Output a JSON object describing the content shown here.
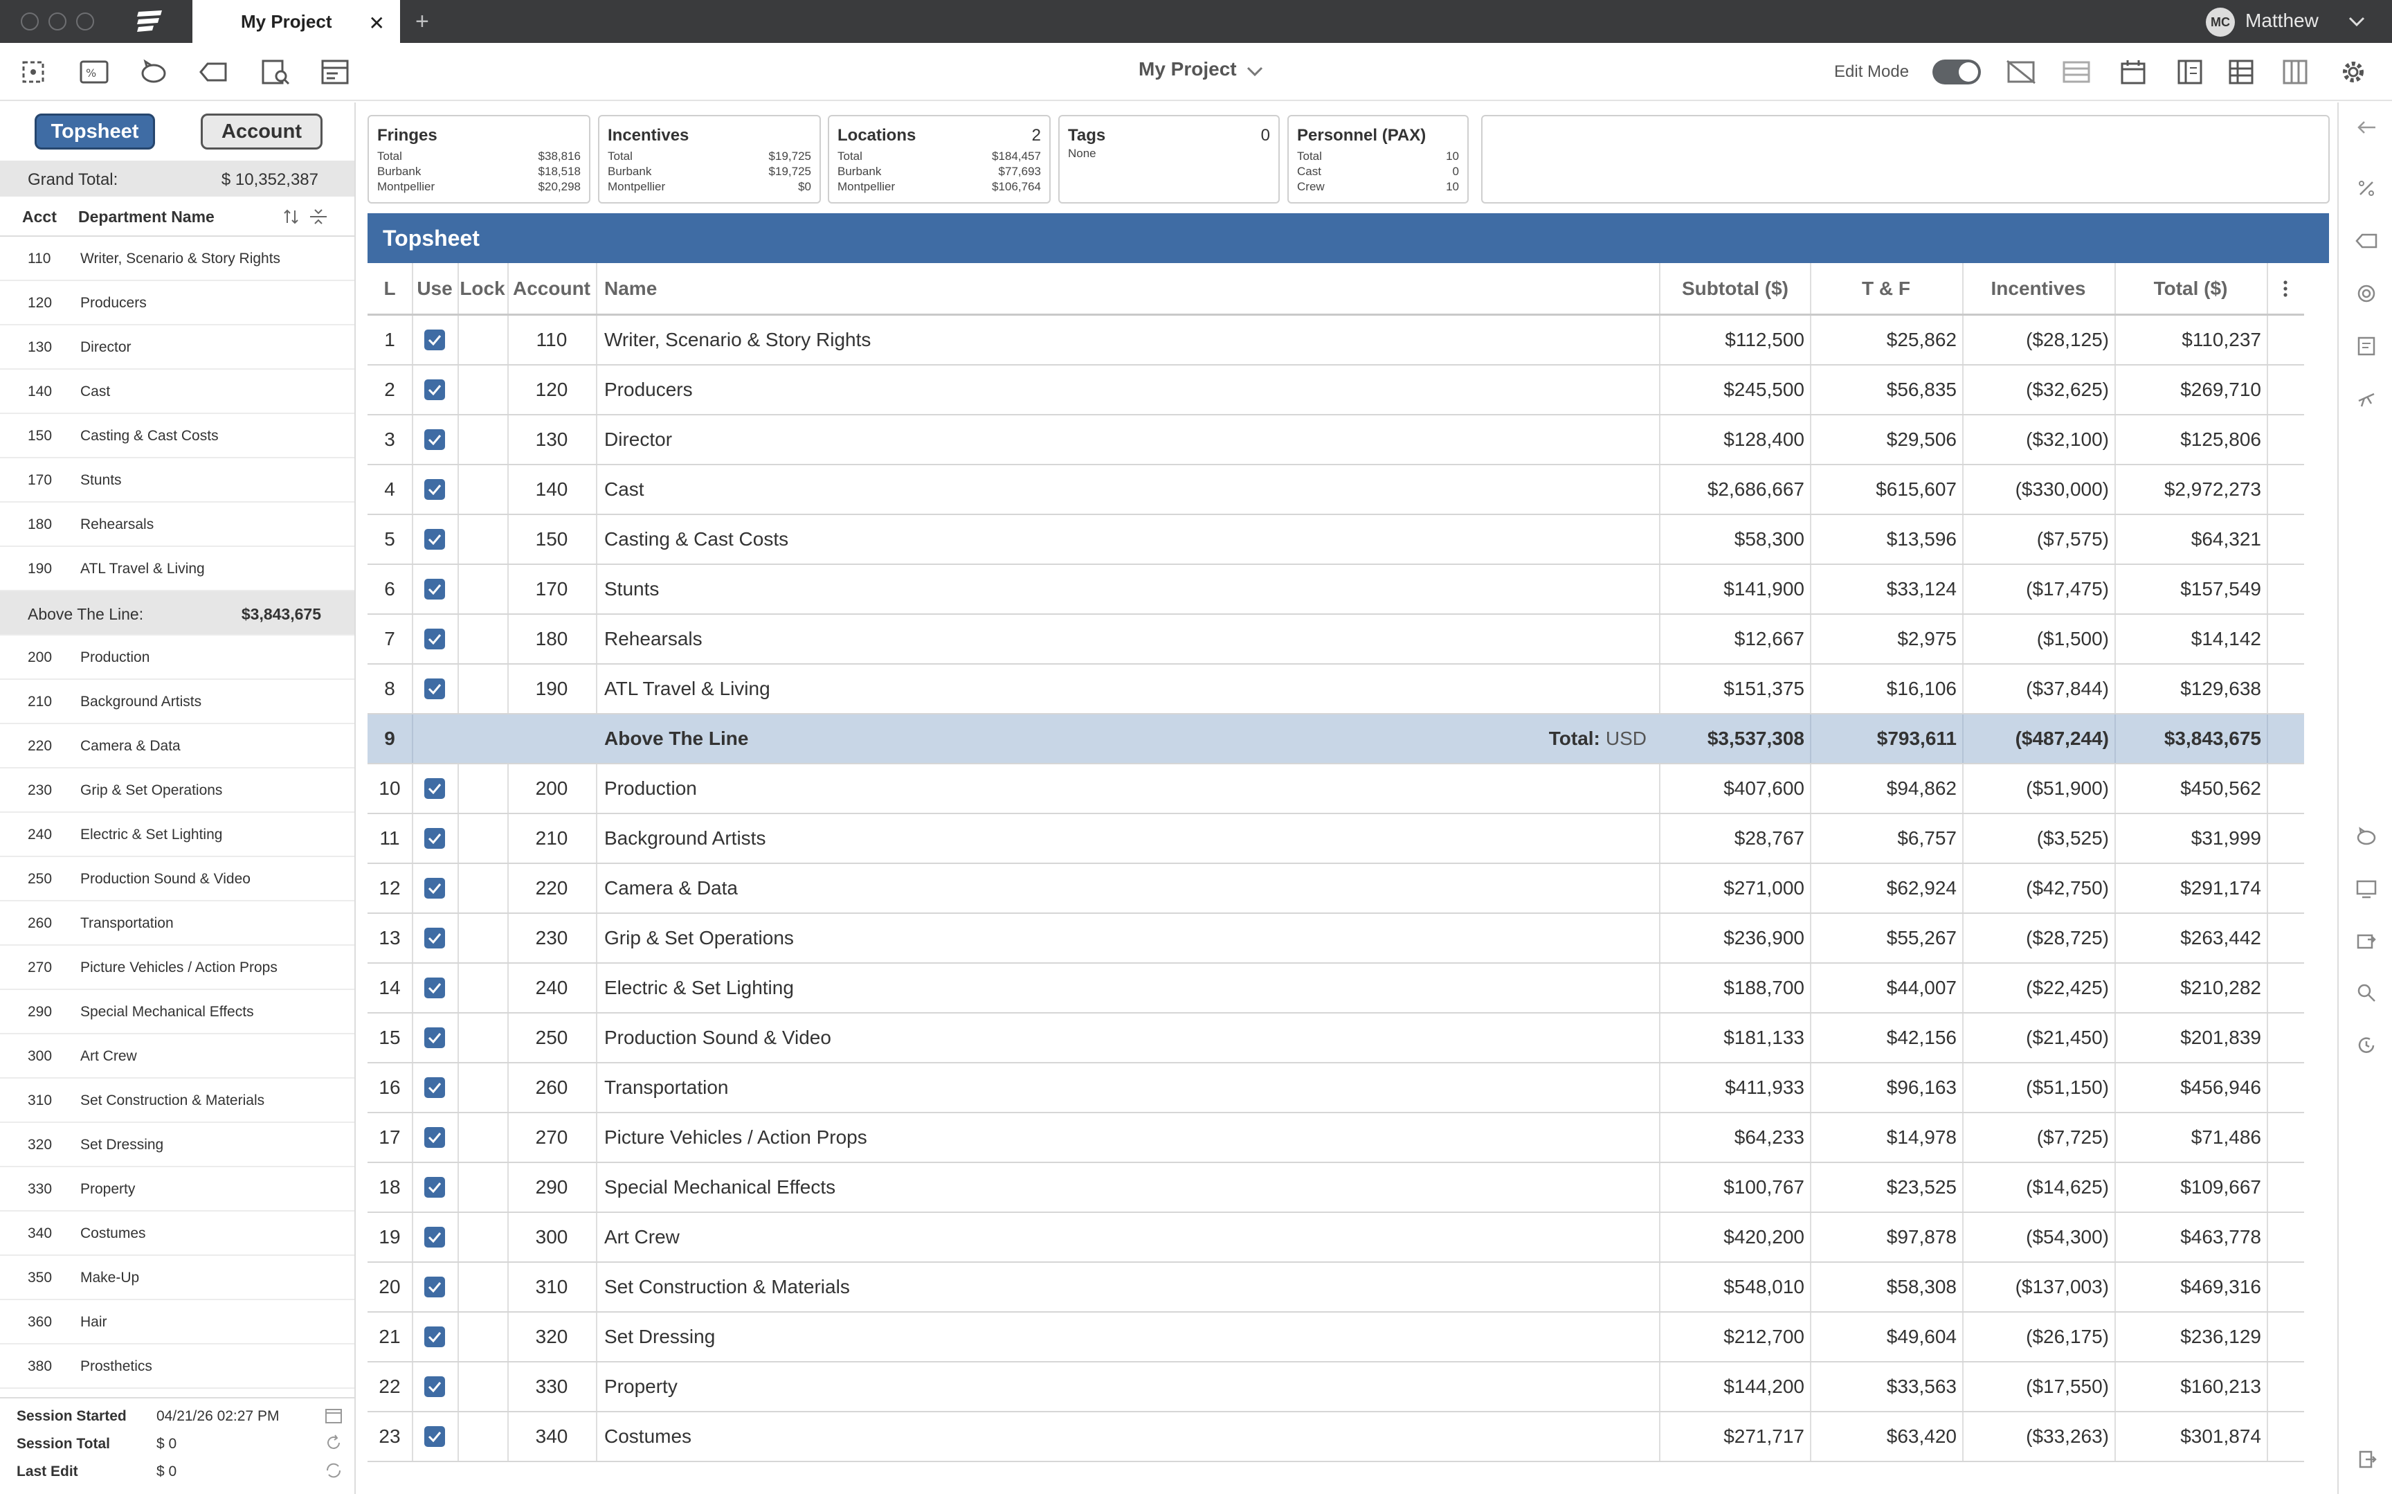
{
  "tab": {
    "title": "My Project"
  },
  "user": {
    "initials": "MC",
    "name": "Matthew"
  },
  "toolbar": {
    "project_title": "My Project",
    "edit_mode_label": "Edit Mode",
    "edit_mode_on": true
  },
  "sidebar": {
    "seg_topsheet": "Topsheet",
    "seg_account": "Account",
    "grand_total_label": "Grand Total:",
    "grand_total_value": "$ 10,352,387",
    "col_acct": "Acct",
    "col_name": "Department Name",
    "rows": [
      {
        "acct": "110",
        "name": "Writer, Scenario & Story Rights"
      },
      {
        "acct": "120",
        "name": "Producers"
      },
      {
        "acct": "130",
        "name": "Director"
      },
      {
        "acct": "140",
        "name": "Cast"
      },
      {
        "acct": "150",
        "name": "Casting & Cast Costs"
      },
      {
        "acct": "170",
        "name": "Stunts"
      },
      {
        "acct": "180",
        "name": "Rehearsals"
      },
      {
        "acct": "190",
        "name": "ATL Travel & Living"
      },
      {
        "acct": "",
        "name": "Above The Line:",
        "total": "$3,843,675",
        "subtotal": true
      },
      {
        "acct": "200",
        "name": "Production"
      },
      {
        "acct": "210",
        "name": "Background Artists"
      },
      {
        "acct": "220",
        "name": "Camera & Data"
      },
      {
        "acct": "230",
        "name": "Grip & Set Operations"
      },
      {
        "acct": "240",
        "name": "Electric & Set Lighting"
      },
      {
        "acct": "250",
        "name": "Production Sound & Video"
      },
      {
        "acct": "260",
        "name": "Transportation"
      },
      {
        "acct": "270",
        "name": "Picture Vehicles / Action Props"
      },
      {
        "acct": "290",
        "name": "Special Mechanical Effects"
      },
      {
        "acct": "300",
        "name": "Art Crew"
      },
      {
        "acct": "310",
        "name": "Set Construction & Materials"
      },
      {
        "acct": "320",
        "name": "Set Dressing"
      },
      {
        "acct": "330",
        "name": "Property"
      },
      {
        "acct": "340",
        "name": "Costumes"
      },
      {
        "acct": "350",
        "name": "Make-Up"
      },
      {
        "acct": "360",
        "name": "Hair"
      },
      {
        "acct": "380",
        "name": "Prosthetics"
      }
    ],
    "session": {
      "started_label": "Session Started",
      "started_value": "04/21/26   02:27 PM",
      "total_label": "Session Total",
      "total_value": "$ 0",
      "last_edit_label": "Last Edit",
      "last_edit_value": "$ 0"
    }
  },
  "cards": {
    "fringes": {
      "title": "Fringes",
      "lines": [
        [
          "Total",
          "$38,816"
        ],
        [
          "Burbank",
          "$18,518"
        ],
        [
          "Montpellier",
          "$20,298"
        ]
      ]
    },
    "incentives": {
      "title": "Incentives",
      "lines": [
        [
          "Total",
          "$19,725"
        ],
        [
          "Burbank",
          "$19,725"
        ],
        [
          "Montpellier",
          "$0"
        ]
      ]
    },
    "locations": {
      "title": "Locations",
      "count": "2",
      "lines": [
        [
          "Total",
          "$184,457"
        ],
        [
          "Burbank",
          "$77,693"
        ],
        [
          "Montpellier",
          "$106,764"
        ]
      ]
    },
    "tags": {
      "title": "Tags",
      "count": "0",
      "lines": [
        [
          "None",
          ""
        ]
      ]
    },
    "personnel": {
      "title": "Personnel (PAX)",
      "lines": [
        [
          "Total",
          "10"
        ],
        [
          "Cast",
          "0"
        ],
        [
          "Crew",
          "10"
        ]
      ]
    }
  },
  "topsheet": {
    "title": "Topsheet",
    "columns": {
      "l": "L",
      "use": "Use",
      "lock": "Lock",
      "account": "Account",
      "name": "Name",
      "subtotal": "Subtotal ($)",
      "tf": "T & F",
      "incentives": "Incentives",
      "total": "Total ($)"
    },
    "total_label": "Total:",
    "currency": "USD",
    "rows": [
      {
        "l": "1",
        "acct": "110",
        "name": "Writer, Scenario & Story Rights",
        "subtotal": "$112,500",
        "tf": "$25,862",
        "inc": "($28,125)",
        "total": "$110,237"
      },
      {
        "l": "2",
        "acct": "120",
        "name": "Producers",
        "subtotal": "$245,500",
        "tf": "$56,835",
        "inc": "($32,625)",
        "total": "$269,710"
      },
      {
        "l": "3",
        "acct": "130",
        "name": "Director",
        "subtotal": "$128,400",
        "tf": "$29,506",
        "inc": "($32,100)",
        "total": "$125,806"
      },
      {
        "l": "4",
        "acct": "140",
        "name": "Cast",
        "subtotal": "$2,686,667",
        "tf": "$615,607",
        "inc": "($330,000)",
        "total": "$2,972,273"
      },
      {
        "l": "5",
        "acct": "150",
        "name": "Casting & Cast Costs",
        "subtotal": "$58,300",
        "tf": "$13,596",
        "inc": "($7,575)",
        "total": "$64,321"
      },
      {
        "l": "6",
        "acct": "170",
        "name": "Stunts",
        "subtotal": "$141,900",
        "tf": "$33,124",
        "inc": "($17,475)",
        "total": "$157,549"
      },
      {
        "l": "7",
        "acct": "180",
        "name": "Rehearsals",
        "subtotal": "$12,667",
        "tf": "$2,975",
        "inc": "($1,500)",
        "total": "$14,142"
      },
      {
        "l": "8",
        "acct": "190",
        "name": "ATL Travel & Living",
        "subtotal": "$151,375",
        "tf": "$16,106",
        "inc": "($37,844)",
        "total": "$129,638"
      },
      {
        "l": "9",
        "acct": "",
        "name": "Above The Line",
        "subtotal": "$3,537,308",
        "tf": "$793,611",
        "inc": "($487,244)",
        "total": "$3,843,675",
        "is_total": true
      },
      {
        "l": "10",
        "acct": "200",
        "name": "Production",
        "subtotal": "$407,600",
        "tf": "$94,862",
        "inc": "($51,900)",
        "total": "$450,562"
      },
      {
        "l": "11",
        "acct": "210",
        "name": "Background Artists",
        "subtotal": "$28,767",
        "tf": "$6,757",
        "inc": "($3,525)",
        "total": "$31,999"
      },
      {
        "l": "12",
        "acct": "220",
        "name": "Camera & Data",
        "subtotal": "$271,000",
        "tf": "$62,924",
        "inc": "($42,750)",
        "total": "$291,174"
      },
      {
        "l": "13",
        "acct": "230",
        "name": "Grip & Set Operations",
        "subtotal": "$236,900",
        "tf": "$55,267",
        "inc": "($28,725)",
        "total": "$263,442"
      },
      {
        "l": "14",
        "acct": "240",
        "name": "Electric & Set Lighting",
        "subtotal": "$188,700",
        "tf": "$44,007",
        "inc": "($22,425)",
        "total": "$210,282"
      },
      {
        "l": "15",
        "acct": "250",
        "name": "Production Sound & Video",
        "subtotal": "$181,133",
        "tf": "$42,156",
        "inc": "($21,450)",
        "total": "$201,839"
      },
      {
        "l": "16",
        "acct": "260",
        "name": "Transportation",
        "subtotal": "$411,933",
        "tf": "$96,163",
        "inc": "($51,150)",
        "total": "$456,946"
      },
      {
        "l": "17",
        "acct": "270",
        "name": "Picture Vehicles / Action Props",
        "subtotal": "$64,233",
        "tf": "$14,978",
        "inc": "($7,725)",
        "total": "$71,486"
      },
      {
        "l": "18",
        "acct": "290",
        "name": "Special Mechanical Effects",
        "subtotal": "$100,767",
        "tf": "$23,525",
        "inc": "($14,625)",
        "total": "$109,667"
      },
      {
        "l": "19",
        "acct": "300",
        "name": "Art Crew",
        "subtotal": "$420,200",
        "tf": "$97,878",
        "inc": "($54,300)",
        "total": "$463,778"
      },
      {
        "l": "20",
        "acct": "310",
        "name": "Set Construction & Materials",
        "subtotal": "$548,010",
        "tf": "$58,308",
        "inc": "($137,003)",
        "total": "$469,316"
      },
      {
        "l": "21",
        "acct": "320",
        "name": "Set Dressing",
        "subtotal": "$212,700",
        "tf": "$49,604",
        "inc": "($26,175)",
        "total": "$236,129"
      },
      {
        "l": "22",
        "acct": "330",
        "name": "Property",
        "subtotal": "$144,200",
        "tf": "$33,563",
        "inc": "($17,550)",
        "total": "$160,213"
      },
      {
        "l": "23",
        "acct": "340",
        "name": "Costumes",
        "subtotal": "$271,717",
        "tf": "$63,420",
        "inc": "($33,263)",
        "total": "$301,874"
      }
    ]
  },
  "colors": {
    "accent": "#3f6ca4",
    "subtotal_row": "#c8d6e6",
    "titlebar": "#3a3b3d"
  }
}
